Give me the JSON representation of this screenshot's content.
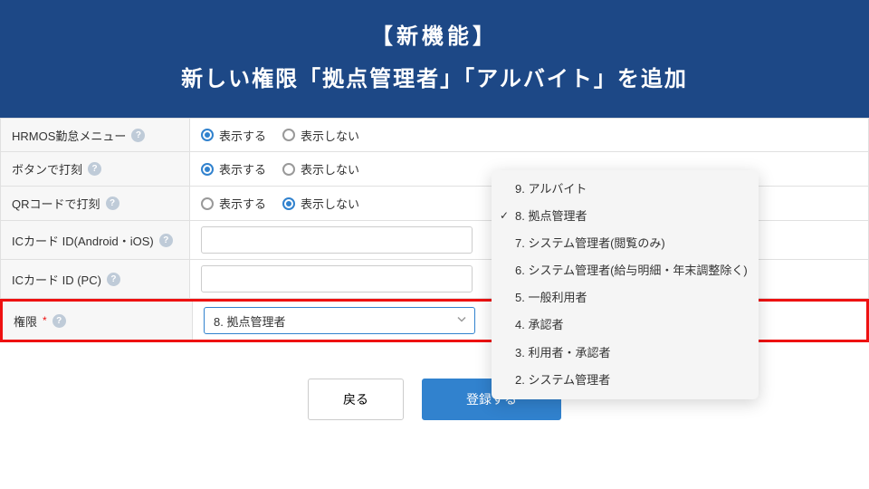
{
  "banner": {
    "line1": "【新機能】",
    "line2": "新しい権限「拠点管理者」「アルバイト」を追加"
  },
  "rows": {
    "menu": {
      "label": "HRMOS勤怠メニュー",
      "opt_show": "表示する",
      "opt_hide": "表示しない"
    },
    "button_punch": {
      "label": "ボタンで打刻",
      "opt_show": "表示する",
      "opt_hide": "表示しない"
    },
    "qr_punch": {
      "label": "QRコードで打刻",
      "opt_show": "表示する",
      "opt_hide": "表示しない"
    },
    "ic_mobile": {
      "label": "ICカード ID(Android・iOS)"
    },
    "ic_pc": {
      "label": "ICカード ID (PC)"
    },
    "perm": {
      "label": "権限",
      "required": "*",
      "selected": "8. 拠点管理者"
    }
  },
  "dropdown": {
    "items": [
      "9. アルバイト",
      "8. 拠点管理者",
      "7. システム管理者(閲覧のみ)",
      "6. システム管理者(給与明細・年末調整除く)",
      "5. 一般利用者",
      "4. 承認者",
      "3. 利用者・承認者",
      "2. システム管理者"
    ],
    "selected_index": 1
  },
  "footer": {
    "back": "戻る",
    "submit": "登録する"
  }
}
